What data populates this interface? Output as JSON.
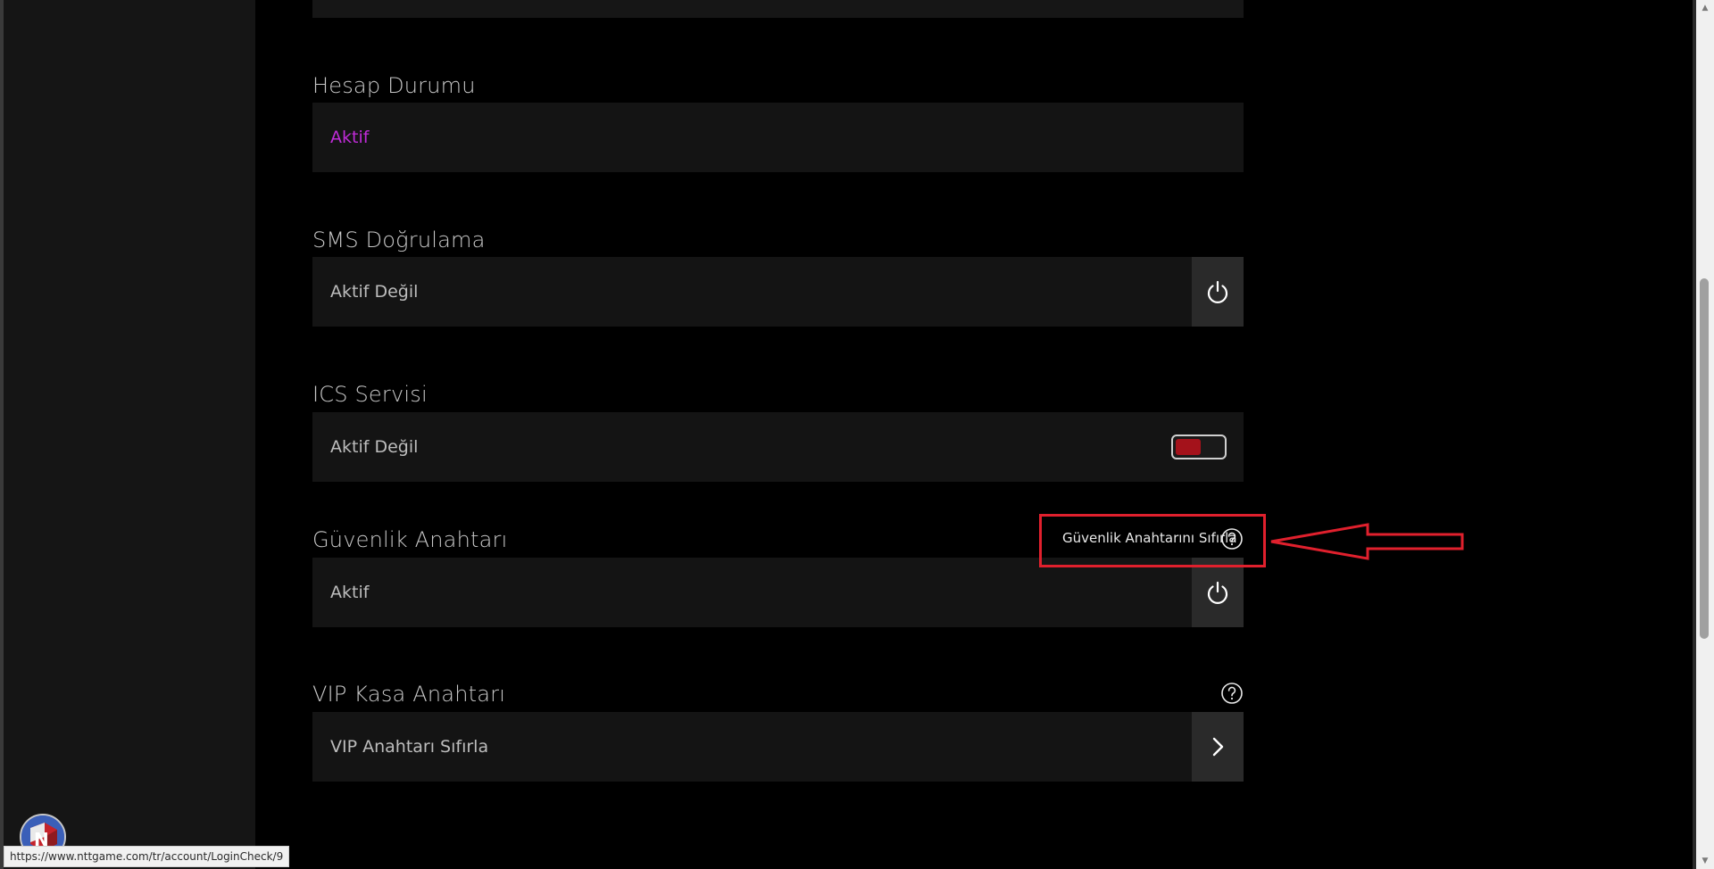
{
  "page": {
    "status_url": "https://www.nttgame.com/tr/account/LoginCheck/9"
  },
  "account_status": {
    "label": "Hesap Durumu",
    "value": "Aktif"
  },
  "sms_verification": {
    "label": "SMS Doğrulama",
    "value": "Aktif Değil",
    "icon": "power-icon"
  },
  "ics_service": {
    "label": "ICS Servisi",
    "value": "Aktif Değil",
    "toggle_on": false
  },
  "security_key": {
    "label": "Güvenlik Anahtarı",
    "value": "Aktif",
    "reset_link": "Güvenlik Anahtarını Sıfırla",
    "icon": "power-icon"
  },
  "vip_vault_key": {
    "label": "VIP Kasa Anahtarı",
    "value": "VIP Anahtarı Sıfırla",
    "icon": "chevron-right-icon"
  },
  "colors": {
    "background": "#000000",
    "field_bg": "#141414",
    "sidebar_bg": "#151515",
    "active_text": "#c02bd8",
    "toggle_off": "#a4121b",
    "annotation_red": "#e0202d"
  }
}
